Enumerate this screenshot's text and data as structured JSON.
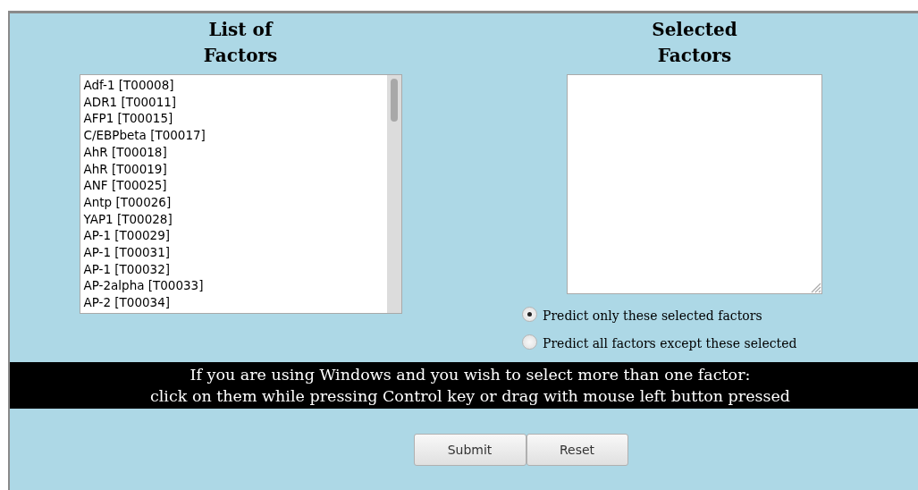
{
  "factor_list": {
    "heading": "List of Factors",
    "items": [
      "Adf-1 [T00008]",
      "ADR1 [T00011]",
      "AFP1 [T00015]",
      "C/EBPbeta [T00017]",
      "AhR [T00018]",
      "AhR [T00019]",
      "ANF [T00025]",
      "Antp [T00026]",
      "YAP1 [T00028]",
      "AP-1 [T00029]",
      "AP-1 [T00031]",
      "AP-1 [T00032]",
      "AP-2alpha [T00033]",
      "AP-2 [T00034]"
    ]
  },
  "selected_factors": {
    "heading": "Selected Factors"
  },
  "prediction_mode": [
    {
      "label": "Predict only these selected factors",
      "selected": true
    },
    {
      "label": "Predict all factors except these selected",
      "selected": false
    }
  ],
  "notice": [
    "If you are using Windows and you wish to select more than one factor:",
    "click on them while pressing Control key or drag with mouse left button pressed"
  ],
  "buttons": [
    "Submit",
    "Reset"
  ]
}
